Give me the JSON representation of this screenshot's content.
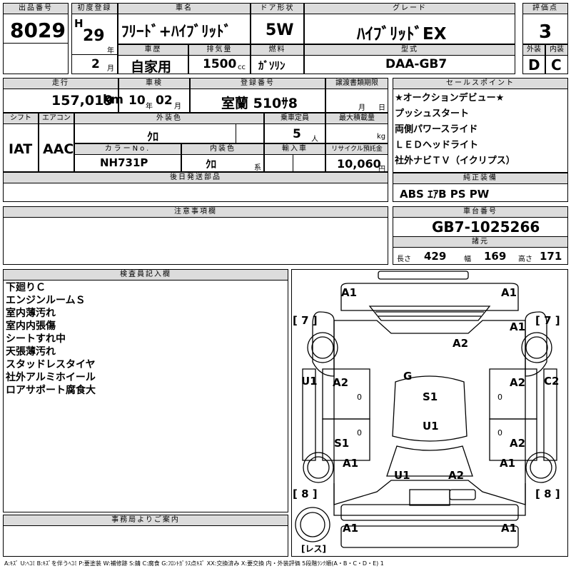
{
  "header": {
    "lot_label": "出品番号",
    "lot": "8029",
    "first_reg_label": "初度登録",
    "era": "H",
    "year": "29",
    "year_unit": "年",
    "month": "2",
    "month_unit": "月",
    "car_name_label": "車名",
    "car_name": "ﾌﾘｰﾄﾞ+ﾊｲﾌﾞﾘｯﾄﾞ",
    "door_label": "ドア形状",
    "door": "5W",
    "grade_label": "グレード",
    "grade": "ﾊｲﾌﾞﾘｯﾄﾞEX",
    "score_label": "評価点",
    "score": "3",
    "history_label": "車歴",
    "history": "自家用",
    "displacement_label": "排気量",
    "displacement": "1500",
    "displacement_unit": "cc",
    "fuel_label": "燃料",
    "fuel": "ｶﾞｿﾘﾝ",
    "model_label": "型式",
    "model": "DAA-GB7",
    "ext_grade_label": "外装",
    "ext_grade": "D",
    "int_grade_label": "内装",
    "int_grade": "C"
  },
  "row2": {
    "mileage_label": "走行",
    "mileage": "157,019",
    "mileage_unit": "km",
    "inspection_label": "車検",
    "inspection_year": "10",
    "inspection_year_unit": "年",
    "inspection_month": "02",
    "inspection_month_unit": "月",
    "plate_label": "登録番号",
    "plate": "室蘭 510ｻ8",
    "transfer_label": "譲渡書類期限",
    "transfer_month_unit": "月",
    "transfer_day_unit": "日",
    "shift_label": "シフト",
    "shift": "IAT",
    "ac_label": "エアコン",
    "ac": "AAC",
    "ext_color_label": "外装色",
    "ext_color": "ｸﾛ",
    "seats_label": "乗車定員",
    "seats": "5",
    "seats_unit": "人",
    "max_load_label": "最大積載量",
    "max_load_unit": "kg",
    "color_no_label": "カラーNo.",
    "color_no": "NH731P",
    "int_color_label": "内装色",
    "int_color": "ｸﾛ",
    "int_color_unit": "系",
    "import_label": "輸入車",
    "recycle_label": "リサイクル預託金",
    "recycle": "10,060",
    "recycle_unit": "円",
    "later_parts_label": "後日発送部品"
  },
  "sales": {
    "label": "セールスポイント",
    "items": [
      "★オークションデビュー★",
      "プッシュスタート",
      "両側パワースライド",
      "ＬＥＤヘッドライト",
      "社外ナビＴＶ（イクリプス）"
    ]
  },
  "equipment": {
    "label": "純正装備",
    "value": "ABS ｴｱB PS PW"
  },
  "notes": {
    "label": "注意事項欄"
  },
  "chassis": {
    "label": "車台番号",
    "value": "GB7-1025266"
  },
  "specs": {
    "label": "諸元",
    "length_label": "長さ",
    "length": "429",
    "width_label": "幅",
    "width": "169",
    "height_label": "高さ",
    "height": "171"
  },
  "inspector": {
    "label": "検査員記入欄",
    "items": [
      "下廻りＣ",
      "エンジンルームＳ",
      "室内薄汚れ",
      "室内内張傷",
      "シートすれ中",
      "天張薄汚れ",
      "スタッドレスタイヤ",
      "社外アルミホイール",
      "ロアサポート腐食大"
    ]
  },
  "office": {
    "label": "事務局よりご案内"
  },
  "diagram": {
    "marks": [
      "A1",
      "A1",
      "A1",
      "A2",
      "G",
      "A2",
      "A2",
      "S1",
      "U1",
      "S1",
      "A2",
      "A1",
      "A1",
      "U1",
      "A2",
      "A1",
      "A1",
      "U1",
      "C2"
    ],
    "tires": [
      "[ 7 ]",
      "[ 7 ]",
      "[ 8 ]",
      "[ 8 ]"
    ],
    "zero": "0",
    "spare": "[レス]"
  },
  "legend": "A:ｷｽﾞ U:ﾍｺﾐ B:ｷｽﾞを伴うﾍｺﾐ P:要塗装 W:補修跡 S:錆 C:腐食 G:ﾌﾛﾝﾄｶﾞﾗｽ点ｷｽﾞ XX:交換済み X:要交換 内・外装評価 5段階ﾗﾝｸ順(A・B・C・D・E) 1"
}
